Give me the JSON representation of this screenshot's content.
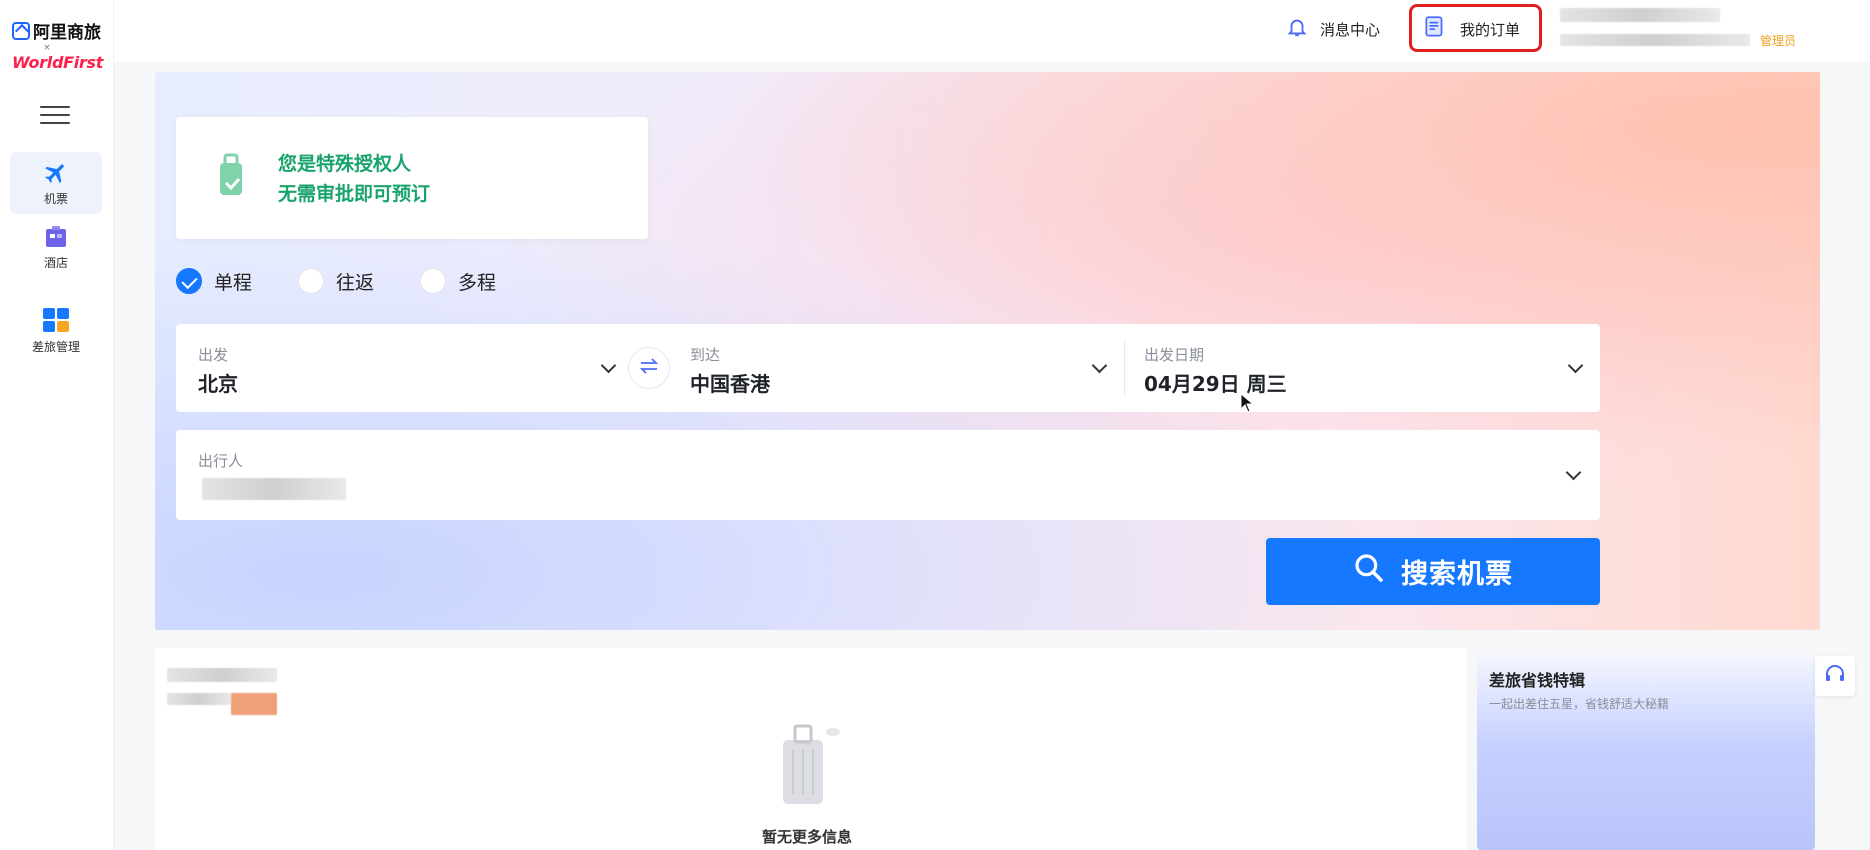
{
  "brand": {
    "name": "阿里商旅",
    "separator": "×",
    "partner": "WorldFirst"
  },
  "sidebar": {
    "items": [
      {
        "label": "机票",
        "icon": "airplane-icon",
        "active": true
      },
      {
        "label": "酒店",
        "icon": "hotel-icon",
        "active": false
      },
      {
        "label": "差旅管理",
        "icon": "grid-icon",
        "active": false
      }
    ]
  },
  "header": {
    "messages_label": "消息中心",
    "orders_label": "我的订单",
    "admin_label": "管理员"
  },
  "auth_notice": {
    "line1": "您是特殊授权人",
    "line2": "无需审批即可预订"
  },
  "trip_types": [
    {
      "label": "单程",
      "checked": true
    },
    {
      "label": "往返",
      "checked": false
    },
    {
      "label": "多程",
      "checked": false
    }
  ],
  "search": {
    "from_label": "出发",
    "from_value": "北京",
    "to_label": "到达",
    "to_value": "中国香港",
    "date_label": "出发日期",
    "date_value": "04月29日 周三",
    "traveler_label": "出行人",
    "button_label": "搜索机票"
  },
  "trips": {
    "empty_text": "暂无更多信息"
  },
  "promo": {
    "title": "差旅省钱特辑",
    "subtitle": "一起出差住五星，省钱舒适大秘籍"
  },
  "colors": {
    "accent": "#1677ff",
    "success": "#19a46c",
    "admin": "#f0a020",
    "highlight": "#e02020"
  }
}
